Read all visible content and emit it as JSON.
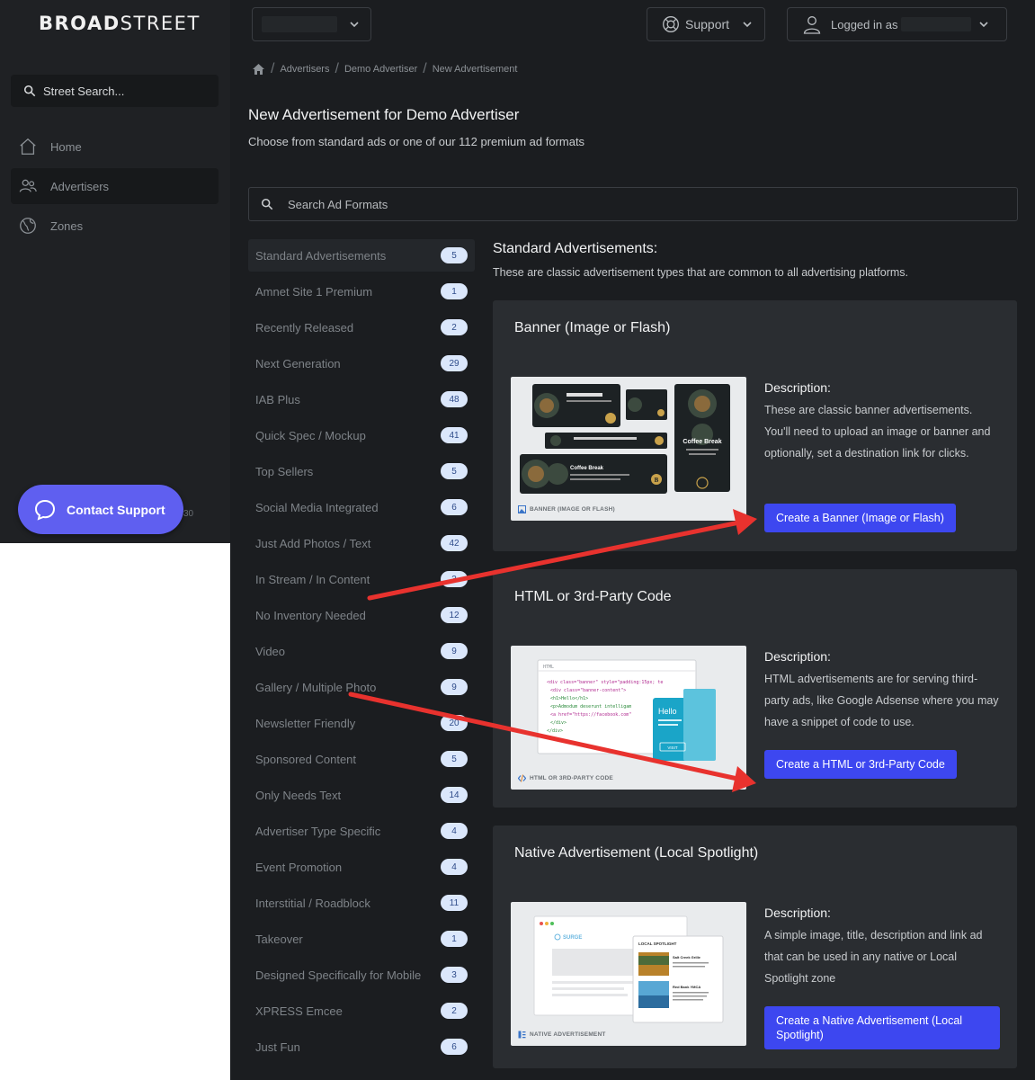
{
  "brand": {
    "logo_bold": "BROAD",
    "logo_light": "STREET"
  },
  "sidebar": {
    "search_label": "Street Search...",
    "items": [
      {
        "label": "Home"
      },
      {
        "label": "Advertisers"
      },
      {
        "label": "Zones"
      }
    ],
    "contact_support": "Contact Support",
    "version_fragment": "30"
  },
  "topbar": {
    "support_label": "Support",
    "logged_in_label": "Logged in as"
  },
  "breadcrumb": [
    "Advertisers",
    "Demo Advertiser",
    "New Advertisement"
  ],
  "page": {
    "title": "New Advertisement for Demo Advertiser",
    "subtitle": "Choose from standard ads or one of our 112 premium ad formats",
    "search_placeholder": "Search Ad Formats"
  },
  "categories": [
    {
      "label": "Standard Advertisements",
      "count": "5"
    },
    {
      "label": "Amnet Site 1 Premium",
      "count": "1"
    },
    {
      "label": "Recently Released",
      "count": "2"
    },
    {
      "label": "Next Generation",
      "count": "29"
    },
    {
      "label": "IAB Plus",
      "count": "48"
    },
    {
      "label": "Quick Spec / Mockup",
      "count": "41"
    },
    {
      "label": "Top Sellers",
      "count": "5"
    },
    {
      "label": "Social Media Integrated",
      "count": "6"
    },
    {
      "label": "Just Add Photos / Text",
      "count": "42"
    },
    {
      "label": "In Stream / In Content",
      "count": "3"
    },
    {
      "label": "No Inventory Needed",
      "count": "12"
    },
    {
      "label": "Video",
      "count": "9"
    },
    {
      "label": "Gallery / Multiple Photo",
      "count": "9"
    },
    {
      "label": "Newsletter Friendly",
      "count": "20"
    },
    {
      "label": "Sponsored Content",
      "count": "5"
    },
    {
      "label": "Only Needs Text",
      "count": "14"
    },
    {
      "label": "Advertiser Type Specific",
      "count": "4"
    },
    {
      "label": "Event Promotion",
      "count": "4"
    },
    {
      "label": "Interstitial / Roadblock",
      "count": "11"
    },
    {
      "label": "Takeover",
      "count": "1"
    },
    {
      "label": "Designed Specifically for Mobile",
      "count": "3"
    },
    {
      "label": "XPRESS Emcee",
      "count": "2"
    },
    {
      "label": "Just Fun",
      "count": "6"
    }
  ],
  "section": {
    "title": "Standard Advertisements:",
    "subtitle": "These are classic advertisement types that are common to all advertising platforms."
  },
  "cards": [
    {
      "title": "Banner (Image or Flash)",
      "desc_head": "Description:",
      "desc": "These are classic banner advertisements. You'll need to upload an image or banner and optionally, set a destination link for clicks.",
      "cta": "Create a Banner (Image or Flash)",
      "caption": "BANNER (IMAGE OR FLASH)",
      "mock": {
        "coffee": "Coffee Break",
        "logo": "B"
      }
    },
    {
      "title": "HTML or 3rd-Party Code",
      "desc_head": "Description:",
      "desc": "HTML advertisements are for serving third-party ads, like Google Adsense where you may have a snippet of code to use.",
      "cta": "Create a HTML or 3rd-Party Code",
      "caption": "HTML OR 3RD-PARTY CODE",
      "mock": {
        "tab": "HTML",
        "code": [
          "<div class=\"banner\" style=\"padding:15px; te",
          "<div class=\"banner-content\">",
          "<h1>Hello</h1>",
          "<p>Admodum deserunt intelligam",
          "<a href=\"https://facebook.com\"",
          "</div>",
          "</div>"
        ],
        "hello": "Hello",
        "visit": "VISIT"
      }
    },
    {
      "title": "Native Advertisement (Local Spotlight)",
      "desc_head": "Description:",
      "desc": "A simple image, title, description and link ad that can be used in any native or Local Spotlight zone",
      "cta": "Create a Native Advertisement (Local Spotlight)",
      "caption": "NATIVE ADVERTISEMENT",
      "mock": {
        "brand": "SURGE",
        "spot_head": "LOCAL SPOTLIGHT",
        "item1": "Salt Creek Grille",
        "item2": "Red Bank YMCA"
      }
    }
  ],
  "colors": {
    "accent": "#3d47f0",
    "support": "#5f5ff0",
    "annotation": "#e8322e"
  }
}
